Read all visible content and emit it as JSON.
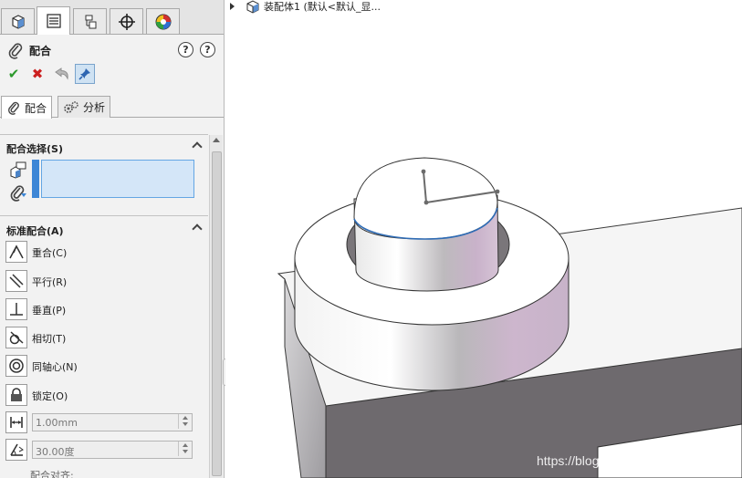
{
  "window": {
    "tree_root_label": "装配体1  (默认<默认_显..."
  },
  "property_manager": {
    "title": "配合",
    "help_label": "?",
    "top_tabs": [
      {
        "icon": "feature-manager-icon"
      },
      {
        "icon": "property-manager-icon"
      },
      {
        "icon": "configuration-manager-icon"
      },
      {
        "icon": "dimxpert-icon"
      },
      {
        "icon": "display-manager-icon"
      }
    ],
    "actions": {
      "ok": "✔",
      "cancel": "✖"
    },
    "sub_tabs": [
      "配合",
      "分析"
    ],
    "mate_selection": {
      "header": "配合选择(S)"
    },
    "standard_mates": {
      "header": "标准配合(A)",
      "items": [
        "重合(C)",
        "平行(R)",
        "垂直(P)",
        "相切(T)",
        "同轴心(N)",
        "锁定(O)"
      ],
      "distance_value": "1.00mm",
      "angle_value": "30.00度"
    },
    "mate_alignment_label": "配合对齐:"
  },
  "watermark": "https://blog.csdn.net/chengoes",
  "colors": {
    "accent": "#3d86d6",
    "selection_fill": "#d4e6f8",
    "ok_green": "#2d9a2d",
    "cancel_red": "#cc2020",
    "plate_dark": "#6e6a6e",
    "edge_blue": "#2f6cb5"
  }
}
